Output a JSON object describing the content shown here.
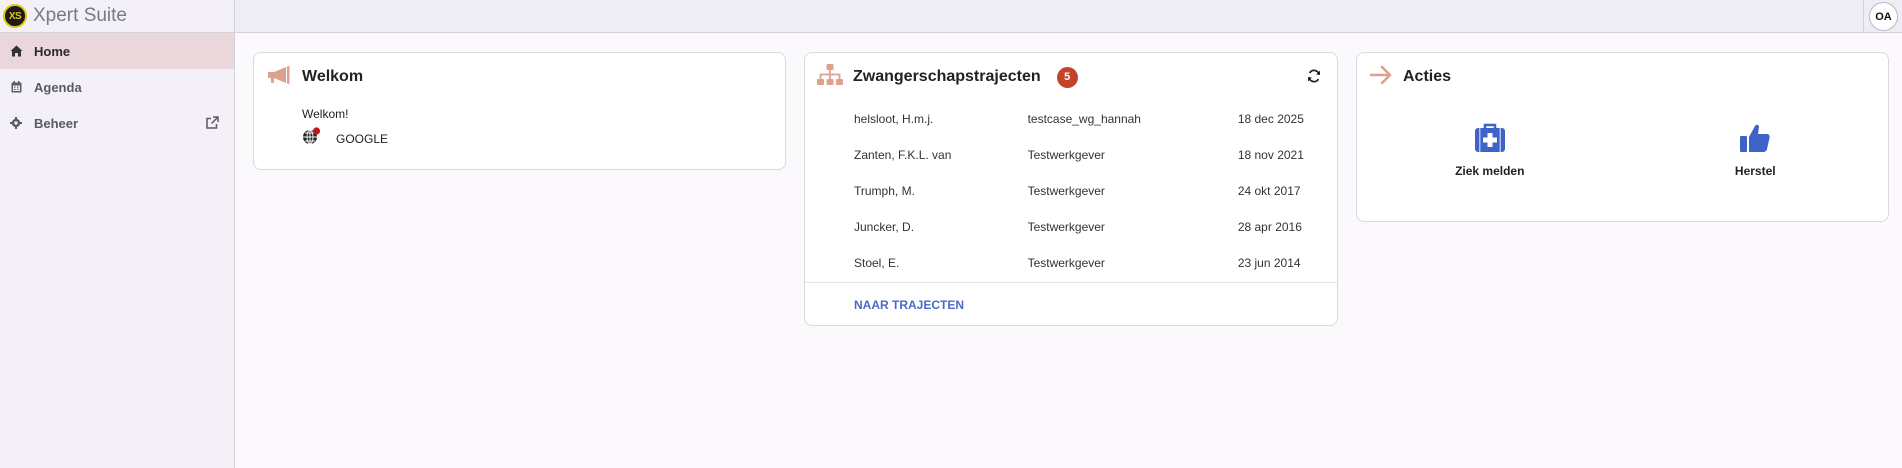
{
  "app": {
    "title": "Xpert Suite",
    "logo_text": "XS"
  },
  "user": {
    "initials": "OA"
  },
  "sidebar": {
    "items": [
      {
        "label": "Home",
        "icon": "home-icon",
        "active": true
      },
      {
        "label": "Agenda",
        "icon": "calendar-icon",
        "active": false
      },
      {
        "label": "Beheer",
        "icon": "gear-icon",
        "active": false
      }
    ]
  },
  "welkom": {
    "title": "Welkom",
    "message": "Welkom!",
    "provider_label": "GOOGLE"
  },
  "trajecten": {
    "title": "Zwangerschapstrajecten",
    "count": "5",
    "rows": [
      {
        "name": "helsloot, H.m.j.",
        "employer": "testcase_wg_hannah",
        "date": "18 dec 2025"
      },
      {
        "name": "Zanten, F.K.L. van",
        "employer": "Testwerkgever",
        "date": "18 nov 2021"
      },
      {
        "name": "Trumph, M.",
        "employer": "Testwerkgever",
        "date": "24 okt 2017"
      },
      {
        "name": "Juncker, D.",
        "employer": "Testwerkgever",
        "date": "28 apr 2016"
      },
      {
        "name": "Stoel, E.",
        "employer": "Testwerkgever",
        "date": "23 jun 2014"
      }
    ],
    "link_label": "NAAR TRAJECTEN"
  },
  "acties": {
    "title": "Acties",
    "items": [
      {
        "label": "Ziek melden",
        "icon": "medkit-icon"
      },
      {
        "label": "Herstel",
        "icon": "thumbs-up-icon"
      }
    ]
  },
  "colors": {
    "accent": "#e0a08e",
    "badge": "#c4442a",
    "link": "#4a6ac8",
    "action_icon": "#3f62c9",
    "active_nav": "#ead7dc"
  }
}
